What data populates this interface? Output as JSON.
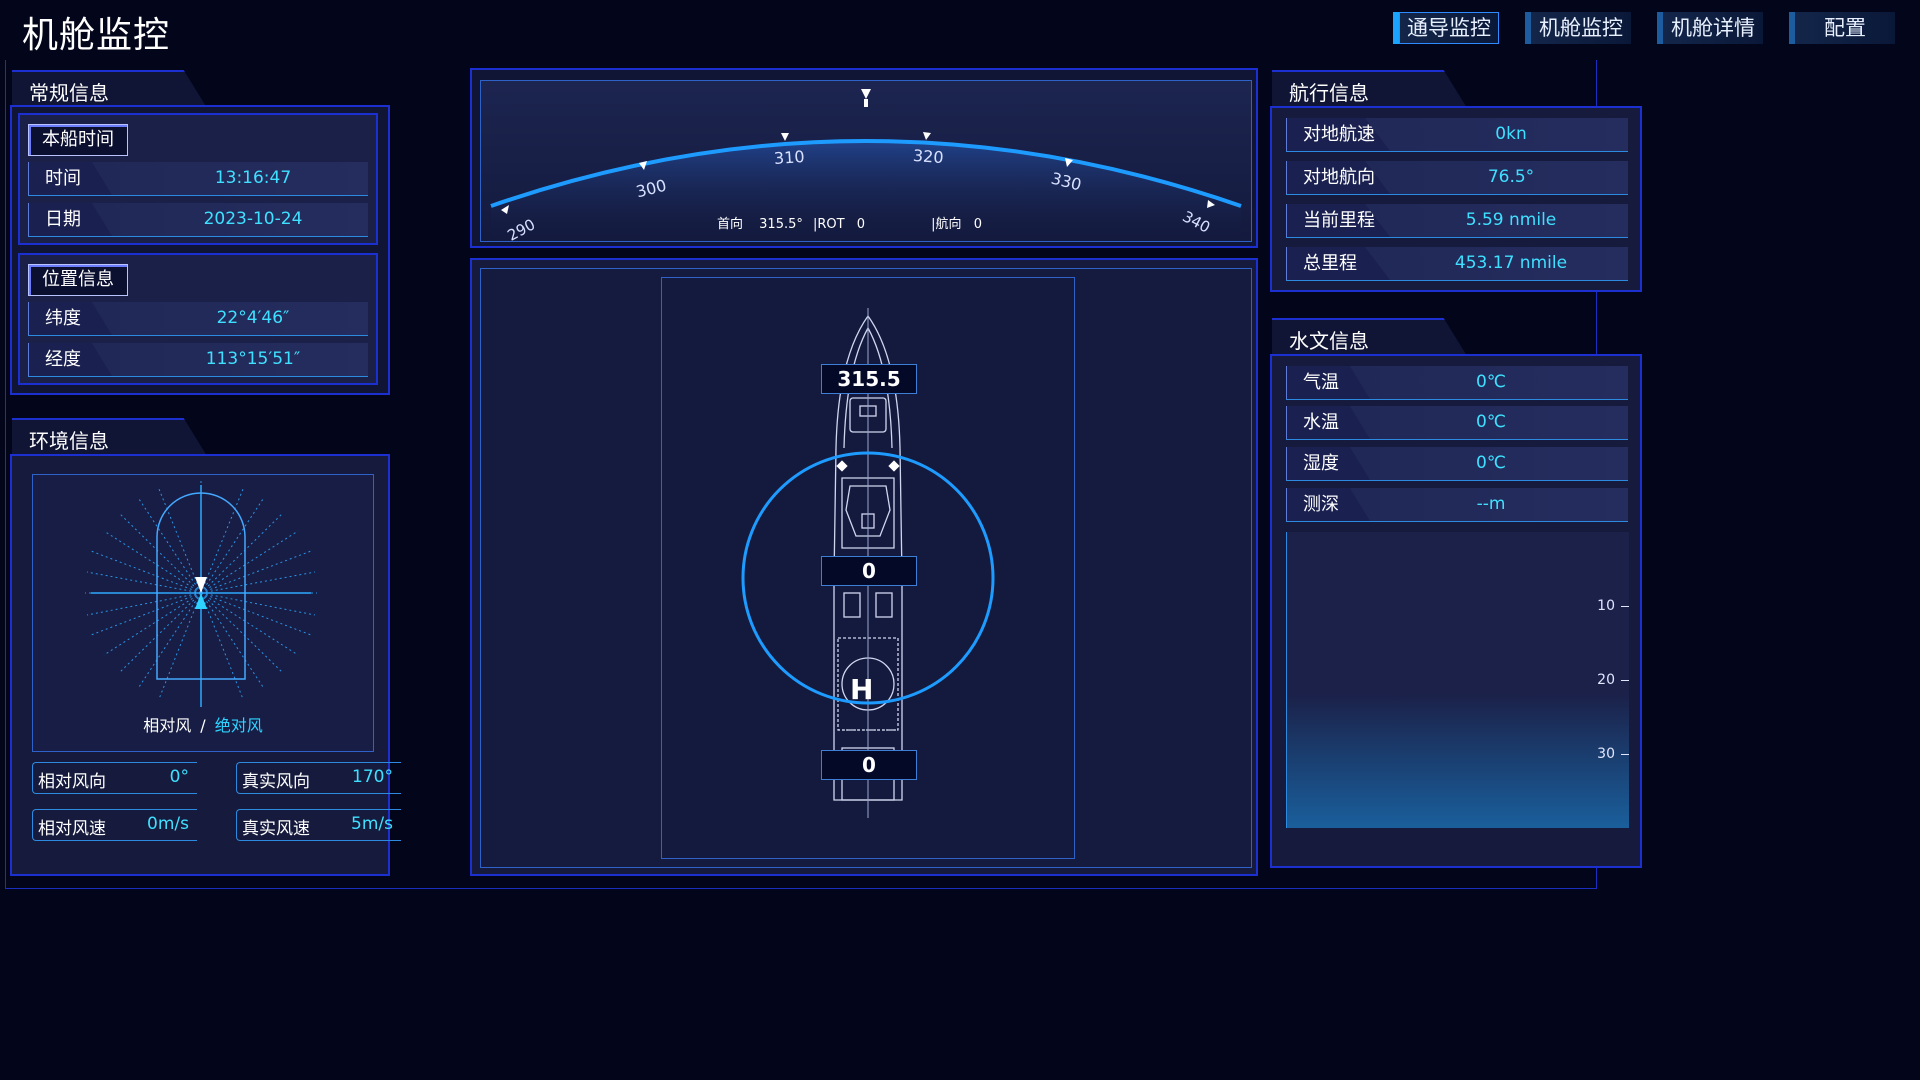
{
  "app": {
    "title": "机舱监控"
  },
  "nav": [
    {
      "label": "通导监控"
    },
    {
      "label": "机舱监控"
    },
    {
      "label": "机舱详情"
    },
    {
      "label": "配置"
    }
  ],
  "general": {
    "tab": "常规信息",
    "time_badge": "本船时间",
    "rows": [
      {
        "label": "时间",
        "value": "13:16:47"
      },
      {
        "label": "日期",
        "value": "2023-10-24"
      }
    ],
    "position_badge": "位置信息",
    "pos_rows": [
      {
        "label": "纬度",
        "value": "22°4′46″"
      },
      {
        "label": "经度",
        "value": "113°15′51″"
      }
    ]
  },
  "environment": {
    "tab": "环境信息",
    "wind_caption_relative": "相对风",
    "wind_caption_sep": "/",
    "wind_caption_absolute": "绝对风",
    "cells": [
      {
        "label": "相对风向",
        "value": "0°"
      },
      {
        "label": "真实风向",
        "value": "170°"
      },
      {
        "label": "相对风速",
        "value": "0m/s"
      },
      {
        "label": "真实风速",
        "value": "5m/s"
      }
    ]
  },
  "compass": {
    "ticks": [
      "290",
      "300",
      "310",
      "320",
      "330",
      "340"
    ],
    "heading_label": "首向",
    "heading_value": "315.5°",
    "rot_label": "|ROT",
    "rot_value": "0",
    "course_label": "|航向",
    "course_value": "0"
  },
  "ship": {
    "heading_box": "315.5",
    "mid_box": "0",
    "aft_box": "0",
    "helipad_letter": "H"
  },
  "navigation": {
    "tab": "航行信息",
    "rows": [
      {
        "label": "对地航速",
        "value": "0kn"
      },
      {
        "label": "对地航向",
        "value": "76.5°"
      },
      {
        "label": "当前里程",
        "value": "5.59 nmile"
      },
      {
        "label": "总里程",
        "value": "453.17 nmile"
      }
    ]
  },
  "hydrology": {
    "tab": "水文信息",
    "rows": [
      {
        "label": "气温",
        "value": "0℃"
      },
      {
        "label": "水温",
        "value": "0℃"
      },
      {
        "label": "湿度",
        "value": "0℃"
      },
      {
        "label": "测深",
        "value": "--m"
      }
    ],
    "depth_ticks": [
      "10",
      "20",
      "30"
    ]
  },
  "colors": {
    "accent": "#1aa3ff",
    "value": "#3fe0ff",
    "border": "#1c2fd0",
    "background": "#03061a"
  }
}
